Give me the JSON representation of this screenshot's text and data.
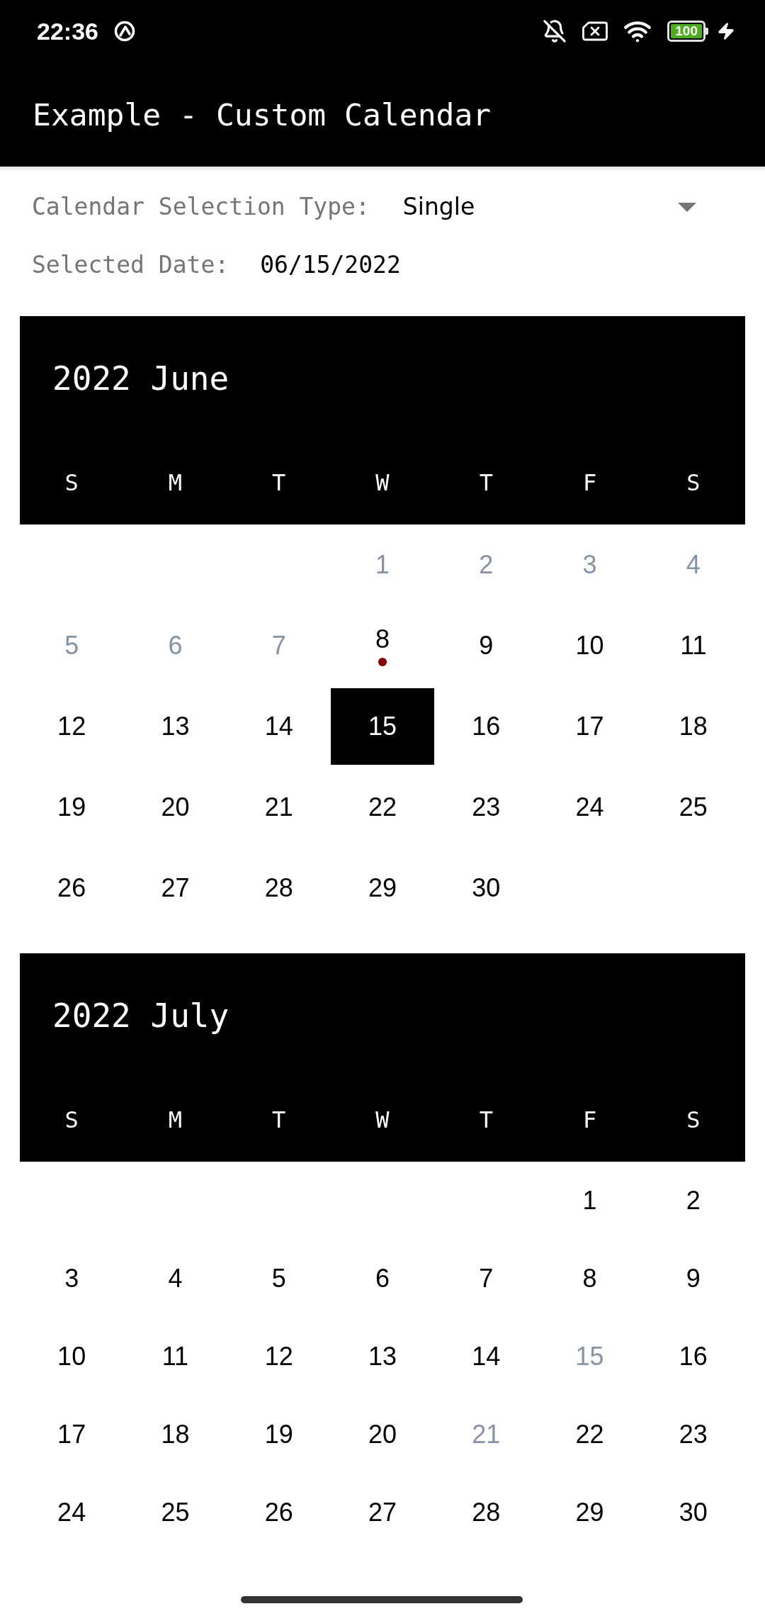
{
  "status_bar": {
    "time": "22:36",
    "battery": "100"
  },
  "app_bar": {
    "title": "Example - Custom Calendar"
  },
  "selection_type": {
    "label": "Calendar Selection Type:",
    "value": "Single"
  },
  "selected_date": {
    "label": "Selected Date:",
    "value": "06/15/2022"
  },
  "months": [
    {
      "title": "2022 June",
      "weekdays": [
        "S",
        "M",
        "T",
        "W",
        "T",
        "F",
        "S"
      ],
      "weeks": [
        [
          {
            "kind": "blank"
          },
          {
            "kind": "blank"
          },
          {
            "kind": "blank"
          },
          {
            "kind": "day",
            "day": "1",
            "selected": false,
            "disabled": true,
            "marked": false
          },
          {
            "kind": "day",
            "day": "2",
            "selected": false,
            "disabled": true,
            "marked": false
          },
          {
            "kind": "day",
            "day": "3",
            "selected": false,
            "disabled": true,
            "marked": false
          },
          {
            "kind": "day",
            "day": "4",
            "selected": false,
            "disabled": true,
            "marked": false
          }
        ],
        [
          {
            "kind": "day",
            "day": "5",
            "selected": false,
            "disabled": true,
            "marked": false
          },
          {
            "kind": "day",
            "day": "6",
            "selected": false,
            "disabled": true,
            "marked": false
          },
          {
            "kind": "day",
            "day": "7",
            "selected": false,
            "disabled": true,
            "marked": false
          },
          {
            "kind": "day",
            "day": "8",
            "selected": false,
            "disabled": false,
            "marked": true
          },
          {
            "kind": "day",
            "day": "9",
            "selected": false,
            "disabled": false,
            "marked": false
          },
          {
            "kind": "day",
            "day": "10",
            "selected": false,
            "disabled": false,
            "marked": false
          },
          {
            "kind": "day",
            "day": "11",
            "selected": false,
            "disabled": false,
            "marked": false
          }
        ],
        [
          {
            "kind": "day",
            "day": "12",
            "selected": false,
            "disabled": false,
            "marked": false
          },
          {
            "kind": "day",
            "day": "13",
            "selected": false,
            "disabled": false,
            "marked": false
          },
          {
            "kind": "day",
            "day": "14",
            "selected": false,
            "disabled": false,
            "marked": false
          },
          {
            "kind": "day",
            "day": "15",
            "selected": true,
            "disabled": false,
            "marked": false
          },
          {
            "kind": "day",
            "day": "16",
            "selected": false,
            "disabled": false,
            "marked": false
          },
          {
            "kind": "day",
            "day": "17",
            "selected": false,
            "disabled": false,
            "marked": false
          },
          {
            "kind": "day",
            "day": "18",
            "selected": false,
            "disabled": false,
            "marked": false
          }
        ],
        [
          {
            "kind": "day",
            "day": "19",
            "selected": false,
            "disabled": false,
            "marked": false
          },
          {
            "kind": "day",
            "day": "20",
            "selected": false,
            "disabled": false,
            "marked": false
          },
          {
            "kind": "day",
            "day": "21",
            "selected": false,
            "disabled": false,
            "marked": false
          },
          {
            "kind": "day",
            "day": "22",
            "selected": false,
            "disabled": false,
            "marked": false
          },
          {
            "kind": "day",
            "day": "23",
            "selected": false,
            "disabled": false,
            "marked": false
          },
          {
            "kind": "day",
            "day": "24",
            "selected": false,
            "disabled": false,
            "marked": false
          },
          {
            "kind": "day",
            "day": "25",
            "selected": false,
            "disabled": false,
            "marked": false
          }
        ],
        [
          {
            "kind": "day",
            "day": "26",
            "selected": false,
            "disabled": false,
            "marked": false
          },
          {
            "kind": "day",
            "day": "27",
            "selected": false,
            "disabled": false,
            "marked": false
          },
          {
            "kind": "day",
            "day": "28",
            "selected": false,
            "disabled": false,
            "marked": false
          },
          {
            "kind": "day",
            "day": "29",
            "selected": false,
            "disabled": false,
            "marked": false
          },
          {
            "kind": "day",
            "day": "30",
            "selected": false,
            "disabled": false,
            "marked": false
          },
          {
            "kind": "blank"
          },
          {
            "kind": "blank"
          }
        ]
      ]
    },
    {
      "title": "2022 July",
      "weekdays": [
        "S",
        "M",
        "T",
        "W",
        "T",
        "F",
        "S"
      ],
      "weeks": [
        [
          {
            "kind": "blank"
          },
          {
            "kind": "blank"
          },
          {
            "kind": "blank"
          },
          {
            "kind": "blank"
          },
          {
            "kind": "blank"
          },
          {
            "kind": "day",
            "day": "1",
            "selected": false,
            "disabled": false,
            "marked": false
          },
          {
            "kind": "day",
            "day": "2",
            "selected": false,
            "disabled": false,
            "marked": false
          }
        ],
        [
          {
            "kind": "day",
            "day": "3",
            "selected": false,
            "disabled": false,
            "marked": false
          },
          {
            "kind": "day",
            "day": "4",
            "selected": false,
            "disabled": false,
            "marked": false
          },
          {
            "kind": "day",
            "day": "5",
            "selected": false,
            "disabled": false,
            "marked": false
          },
          {
            "kind": "day",
            "day": "6",
            "selected": false,
            "disabled": false,
            "marked": false
          },
          {
            "kind": "day",
            "day": "7",
            "selected": false,
            "disabled": false,
            "marked": false
          },
          {
            "kind": "day",
            "day": "8",
            "selected": false,
            "disabled": false,
            "marked": false
          },
          {
            "kind": "day",
            "day": "9",
            "selected": false,
            "disabled": false,
            "marked": false
          }
        ],
        [
          {
            "kind": "day",
            "day": "10",
            "selected": false,
            "disabled": false,
            "marked": false
          },
          {
            "kind": "day",
            "day": "11",
            "selected": false,
            "disabled": false,
            "marked": false
          },
          {
            "kind": "day",
            "day": "12",
            "selected": false,
            "disabled": false,
            "marked": false
          },
          {
            "kind": "day",
            "day": "13",
            "selected": false,
            "disabled": false,
            "marked": false
          },
          {
            "kind": "day",
            "day": "14",
            "selected": false,
            "disabled": false,
            "marked": false
          },
          {
            "kind": "day",
            "day": "15",
            "selected": false,
            "disabled": true,
            "marked": false
          },
          {
            "kind": "day",
            "day": "16",
            "selected": false,
            "disabled": false,
            "marked": false
          }
        ],
        [
          {
            "kind": "day",
            "day": "17",
            "selected": false,
            "disabled": false,
            "marked": false
          },
          {
            "kind": "day",
            "day": "18",
            "selected": false,
            "disabled": false,
            "marked": false
          },
          {
            "kind": "day",
            "day": "19",
            "selected": false,
            "disabled": false,
            "marked": false
          },
          {
            "kind": "day",
            "day": "20",
            "selected": false,
            "disabled": false,
            "marked": false
          },
          {
            "kind": "day",
            "day": "21",
            "selected": false,
            "disabled": true,
            "marked": false
          },
          {
            "kind": "day",
            "day": "22",
            "selected": false,
            "disabled": false,
            "marked": false
          },
          {
            "kind": "day",
            "day": "23",
            "selected": false,
            "disabled": false,
            "marked": false
          }
        ],
        [
          {
            "kind": "day",
            "day": "24",
            "selected": false,
            "disabled": false,
            "marked": false
          },
          {
            "kind": "day",
            "day": "25",
            "selected": false,
            "disabled": false,
            "marked": false
          },
          {
            "kind": "day",
            "day": "26",
            "selected": false,
            "disabled": false,
            "marked": false
          },
          {
            "kind": "day",
            "day": "27",
            "selected": false,
            "disabled": false,
            "marked": false
          },
          {
            "kind": "day",
            "day": "28",
            "selected": false,
            "disabled": false,
            "marked": false
          },
          {
            "kind": "day",
            "day": "29",
            "selected": false,
            "disabled": false,
            "marked": false
          },
          {
            "kind": "day",
            "day": "30",
            "selected": false,
            "disabled": false,
            "marked": false
          }
        ]
      ]
    }
  ]
}
